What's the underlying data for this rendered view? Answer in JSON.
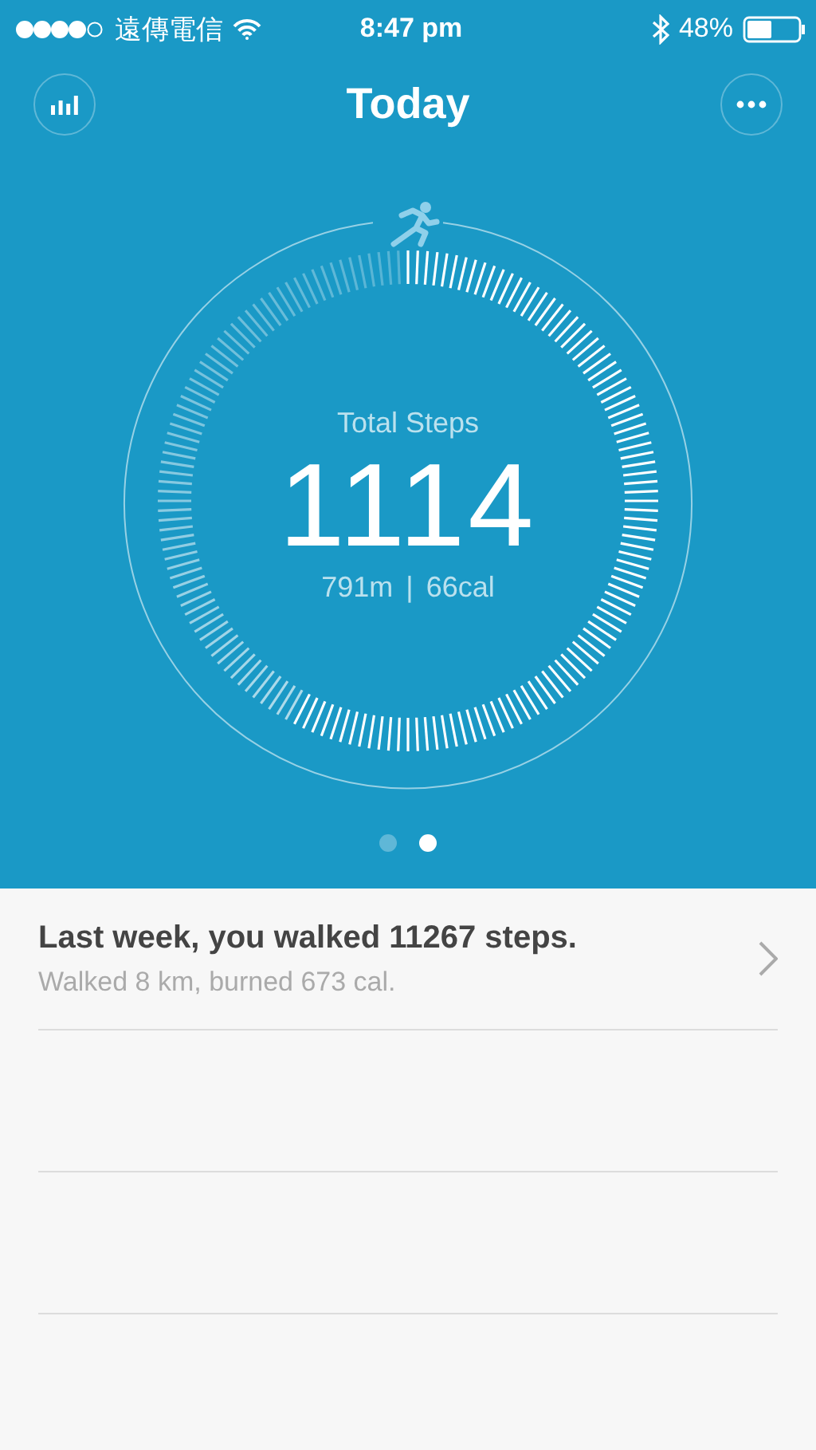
{
  "status_bar": {
    "carrier": "遠傳電信",
    "time": "8:47 pm",
    "battery": "48%"
  },
  "header": {
    "title": "Today"
  },
  "ring": {
    "label": "Total Steps",
    "steps": "1114",
    "distance": "791m",
    "separator": "|",
    "calories": "66cal"
  },
  "pager": [
    {
      "selected": false
    },
    {
      "selected": true
    }
  ],
  "summary": {
    "title": "Last week, you walked 11267 steps.",
    "subtitle": "Walked 8 km, burned 673 cal."
  }
}
